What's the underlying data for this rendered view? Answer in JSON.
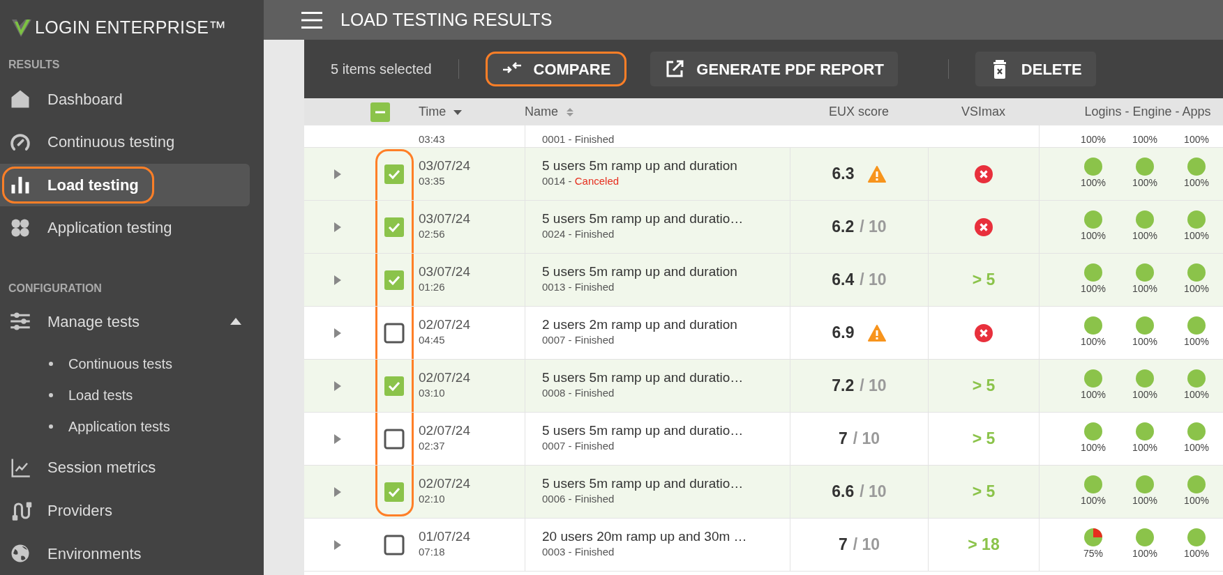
{
  "sidebar": {
    "logo": {
      "text": "LOGIN ENTERPRISE™"
    },
    "sections": [
      {
        "heading": "RESULTS",
        "items": [
          {
            "label": "Dashboard",
            "kind": "home",
            "selected": false,
            "outlined": false
          },
          {
            "label": "Continuous testing",
            "kind": "gauge",
            "selected": false,
            "outlined": false
          },
          {
            "label": "Load testing",
            "kind": "bars",
            "selected": true,
            "outlined": true
          },
          {
            "label": "Application testing",
            "kind": "clover",
            "selected": false,
            "outlined": false
          }
        ]
      },
      {
        "heading": "CONFIGURATION",
        "items": [
          {
            "label": "Manage tests",
            "kind": "sliders",
            "selected": false,
            "outlined": false,
            "expanded": true,
            "children": [
              {
                "label": "Continuous tests"
              },
              {
                "label": "Load tests"
              },
              {
                "label": "Application tests"
              }
            ]
          },
          {
            "label": "Session metrics",
            "kind": "chart",
            "selected": false,
            "outlined": false
          },
          {
            "label": "Providers",
            "kind": "plug",
            "selected": false,
            "outlined": false
          },
          {
            "label": "Environments",
            "kind": "globe",
            "selected": false,
            "outlined": false
          }
        ]
      }
    ]
  },
  "header": {
    "title": "LOAD TESTING RESULTS"
  },
  "toolbar": {
    "selection_text": "5 items selected",
    "button_groups": [
      [
        {
          "label": "COMPARE",
          "kind": "compare",
          "outlined": true
        },
        {
          "label": "GENERATE PDF REPORT",
          "kind": "pdf",
          "outlined": false
        }
      ],
      [
        {
          "label": "DELETE",
          "kind": "delete",
          "outlined": false
        }
      ]
    ]
  },
  "table": {
    "select_all": {
      "indeterminate": true
    },
    "columns": [
      {
        "label": "Time",
        "sortable": true,
        "sorted": true
      },
      {
        "label": "Name",
        "sortable": true,
        "sorted": false
      },
      {
        "label": "EUX score",
        "sortable": false
      },
      {
        "label": "VSImax",
        "sortable": false
      },
      {
        "label": "Logins - Engine - Apps",
        "sortable": false
      }
    ],
    "rows": [
      {
        "kind": "partial",
        "time": "03:43",
        "run": "0001 - ",
        "status": "Finished",
        "canceled": false,
        "logins": [
          {
            "label": "100%"
          },
          {
            "label": "100%"
          },
          {
            "label": "100%"
          }
        ]
      },
      {
        "kind": "full",
        "selected": true,
        "in_outline": true,
        "date": "03/07/24",
        "time": "03:35",
        "name": "5 users 5m ramp up and duration",
        "run": "0014 - ",
        "status": "Canceled",
        "canceled": true,
        "eux": "6.3",
        "eux_warning": true,
        "vsimax": {
          "kind": "fail"
        },
        "logins": [
          {
            "degraded": false,
            "label": "100%"
          },
          {
            "degraded": false,
            "label": "100%"
          },
          {
            "degraded": false,
            "label": "100%"
          }
        ]
      },
      {
        "kind": "full",
        "selected": true,
        "in_outline": true,
        "date": "03/07/24",
        "time": "02:56",
        "name": "5 users 5m ramp up and duratio…",
        "run": "0024 - ",
        "status": "Finished",
        "canceled": false,
        "eux": "6.2",
        "eux_max": "/ 10",
        "eux_warning": false,
        "vsimax": {
          "kind": "fail"
        },
        "logins": [
          {
            "degraded": false,
            "label": "100%"
          },
          {
            "degraded": false,
            "label": "100%"
          },
          {
            "degraded": false,
            "label": "100%"
          }
        ]
      },
      {
        "kind": "full",
        "selected": true,
        "in_outline": true,
        "date": "03/07/24",
        "time": "01:26",
        "name": "5 users 5m ramp up and duration",
        "run": "0013 - ",
        "status": "Finished",
        "canceled": false,
        "eux": "6.4",
        "eux_max": "/ 10",
        "eux_warning": false,
        "vsimax": {
          "kind": "value",
          "text": "> 5"
        },
        "logins": [
          {
            "degraded": false,
            "label": "100%"
          },
          {
            "degraded": false,
            "label": "100%"
          },
          {
            "degraded": false,
            "label": "100%"
          }
        ]
      },
      {
        "kind": "full",
        "selected": false,
        "in_outline": true,
        "date": "02/07/24",
        "time": "04:45",
        "name": "2 users 2m ramp up and duration",
        "run": "0007 - ",
        "status": "Finished",
        "canceled": false,
        "eux": "6.9",
        "eux_warning": true,
        "vsimax": {
          "kind": "fail"
        },
        "logins": [
          {
            "degraded": false,
            "label": "100%"
          },
          {
            "degraded": false,
            "label": "100%"
          },
          {
            "degraded": false,
            "label": "100%"
          }
        ]
      },
      {
        "kind": "full",
        "selected": true,
        "in_outline": true,
        "date": "02/07/24",
        "time": "03:10",
        "name": "5 users 5m ramp up and duratio…",
        "run": "0008 - ",
        "status": "Finished",
        "canceled": false,
        "eux": "7.2",
        "eux_max": "/ 10",
        "eux_warning": false,
        "vsimax": {
          "kind": "value",
          "text": "> 5"
        },
        "logins": [
          {
            "degraded": false,
            "label": "100%"
          },
          {
            "degraded": false,
            "label": "100%"
          },
          {
            "degraded": false,
            "label": "100%"
          }
        ]
      },
      {
        "kind": "full",
        "selected": false,
        "in_outline": true,
        "date": "02/07/24",
        "time": "02:37",
        "name": "5 users 5m ramp up and duratio…",
        "run": "0007 - ",
        "status": "Finished",
        "canceled": false,
        "eux": "7",
        "eux_max": "/ 10",
        "eux_warning": false,
        "vsimax": {
          "kind": "value",
          "text": "> 5"
        },
        "logins": [
          {
            "degraded": false,
            "label": "100%"
          },
          {
            "degraded": false,
            "label": "100%"
          },
          {
            "degraded": false,
            "label": "100%"
          }
        ]
      },
      {
        "kind": "full",
        "selected": true,
        "in_outline": true,
        "date": "02/07/24",
        "time": "02:10",
        "name": "5 users 5m ramp up and duratio…",
        "run": "0006 - ",
        "status": "Finished",
        "canceled": false,
        "eux": "6.6",
        "eux_max": "/ 10",
        "eux_warning": false,
        "vsimax": {
          "kind": "value",
          "text": "> 5"
        },
        "logins": [
          {
            "degraded": false,
            "label": "100%"
          },
          {
            "degraded": false,
            "label": "100%"
          },
          {
            "degraded": false,
            "label": "100%"
          }
        ]
      },
      {
        "kind": "full",
        "selected": false,
        "in_outline": false,
        "date": "01/07/24",
        "time": "07:18",
        "name": "20 users 20m ramp up and 30m …",
        "run": "0003 - ",
        "status": "Finished",
        "canceled": false,
        "eux": "7",
        "eux_max": "/ 10",
        "eux_warning": false,
        "vsimax": {
          "kind": "value",
          "text": "> 18"
        },
        "logins": [
          {
            "degraded": true,
            "label": "75%"
          },
          {
            "degraded": false,
            "label": "100%"
          },
          {
            "degraded": false,
            "label": "100%"
          }
        ]
      }
    ]
  }
}
